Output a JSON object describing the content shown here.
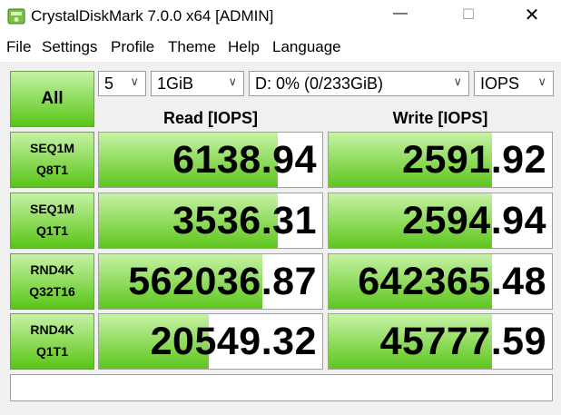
{
  "window": {
    "title": "CrystalDiskMark 7.0.0 x64 [ADMIN]",
    "minimize": "—",
    "maximize": "☐",
    "close": "✕"
  },
  "menu": [
    "File",
    "Settings",
    "Profile",
    "Theme",
    "Help",
    "Language"
  ],
  "controls": {
    "all_label": "All",
    "count": "5",
    "size": "1GiB",
    "drive": "D: 0% (0/233GiB)",
    "unit": "IOPS"
  },
  "headers": {
    "read": "Read [IOPS]",
    "write": "Write [IOPS]"
  },
  "rows": [
    {
      "line1": "SEQ1M",
      "line2": "Q8T1",
      "read": "6138.94",
      "write": "2591.92",
      "read_fill": 0.8,
      "write_fill": 0.73
    },
    {
      "line1": "SEQ1M",
      "line2": "Q1T1",
      "read": "3536.31",
      "write": "2594.94",
      "read_fill": 0.8,
      "write_fill": 0.73
    },
    {
      "line1": "RND4K",
      "line2": "Q32T16",
      "read": "562036.87",
      "write": "642365.48",
      "read_fill": 0.73,
      "write_fill": 0.73
    },
    {
      "line1": "RND4K",
      "line2": "Q1T1",
      "read": "20549.32",
      "write": "45777.59",
      "read_fill": 0.49,
      "write_fill": 0.73
    }
  ],
  "comment": "",
  "colors": {
    "accent_green": "#58c516",
    "light_green": "#c6f2a5"
  }
}
